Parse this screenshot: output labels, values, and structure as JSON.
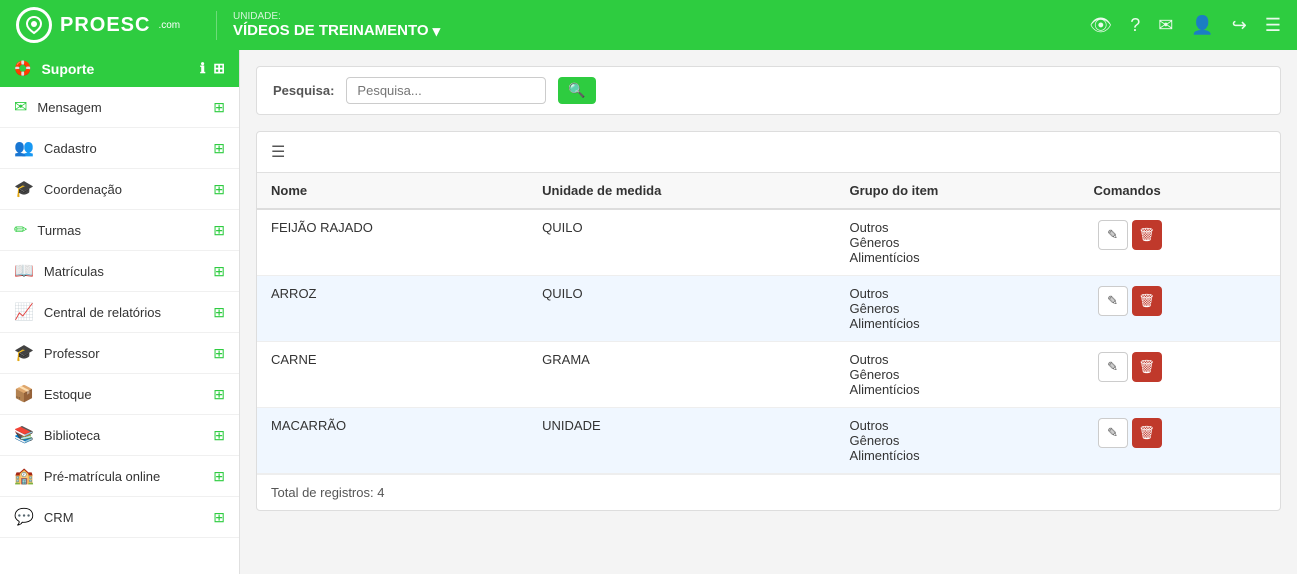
{
  "navbar": {
    "logo_text": "PROESC",
    "logo_com": ".com",
    "unit_label": "UNIDADE:",
    "unit_name": "VÍDEOS DE TREINAMENTO",
    "icons": [
      "eye-icon",
      "question-icon",
      "mail-icon",
      "user-icon",
      "signout-icon",
      "menu-icon"
    ]
  },
  "sidebar": {
    "header": "Suporte",
    "items": [
      {
        "id": "mensagem",
        "label": "Mensagem",
        "icon": "✉"
      },
      {
        "id": "cadastro",
        "label": "Cadastro",
        "icon": "👥"
      },
      {
        "id": "coordenacao",
        "label": "Coordenação",
        "icon": "🎓"
      },
      {
        "id": "turmas",
        "label": "Turmas",
        "icon": "✏"
      },
      {
        "id": "matriculas",
        "label": "Matrículas",
        "icon": "📖"
      },
      {
        "id": "central-relatorios",
        "label": "Central de relatórios",
        "icon": "📈"
      },
      {
        "id": "professor",
        "label": "Professor",
        "icon": "🎓"
      },
      {
        "id": "estoque",
        "label": "Estoque",
        "icon": "📦"
      },
      {
        "id": "biblioteca",
        "label": "Biblioteca",
        "icon": "📚"
      },
      {
        "id": "pre-matricula",
        "label": "Pré-matrícula online",
        "icon": "🏫"
      },
      {
        "id": "crm",
        "label": "CRM",
        "icon": "💬"
      }
    ]
  },
  "search": {
    "label": "Pesquisa:",
    "placeholder": "Pesquisa...",
    "button_label": "🔍"
  },
  "table": {
    "columns": [
      "Nome",
      "Unidade de medida",
      "Grupo do item",
      "Comandos"
    ],
    "rows": [
      {
        "nome": "FEIJÃO RAJADO",
        "unidade": "QUILO",
        "grupo": "Outros Gêneros Alimentícios"
      },
      {
        "nome": "ARROZ",
        "unidade": "QUILO",
        "grupo": "Outros Gêneros Alimentícios"
      },
      {
        "nome": "CARNE",
        "unidade": "GRAMA",
        "grupo": "Outros Gêneros Alimentícios"
      },
      {
        "nome": "MACARRÃO",
        "unidade": "UNIDADE",
        "grupo": "Outros Gêneros Alimentícios"
      }
    ],
    "footer": "Total de registros: 4",
    "edit_label": "✎",
    "delete_label": "🗑"
  }
}
